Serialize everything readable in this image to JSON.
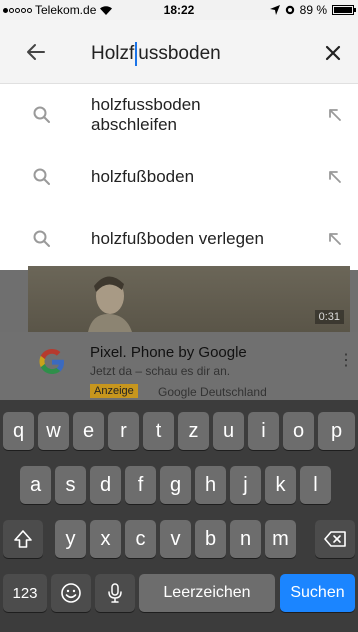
{
  "status_bar": {
    "carrier": "Telekom.de",
    "time": "18:22",
    "battery": "89 %"
  },
  "search": {
    "query_before_caret": "Holzf",
    "query_after_caret": "ussboden"
  },
  "suggestions": [
    {
      "label": "holzfussboden abschleifen"
    },
    {
      "label": "holzfußboden"
    },
    {
      "label": "holzfußboden verlegen"
    }
  ],
  "background": {
    "video_duration": "0:31",
    "ad_title": "Pixel. Phone by Google",
    "ad_subtitle": "Jetzt da – schau es dir an.",
    "ad_badge": "Anzeige",
    "ad_advertiser": "Google Deutschland"
  },
  "keyboard": {
    "row1": [
      "q",
      "w",
      "e",
      "r",
      "t",
      "z",
      "u",
      "i",
      "o",
      "p"
    ],
    "row2": [
      "a",
      "s",
      "d",
      "f",
      "g",
      "h",
      "j",
      "k",
      "l"
    ],
    "row3": [
      "y",
      "x",
      "c",
      "v",
      "b",
      "n",
      "m"
    ],
    "numbers_label": "123",
    "space_label": "Leerzeichen",
    "action_label": "Suchen"
  },
  "colors": {
    "caret": "#1a73e8",
    "action_key": "#1b85ff",
    "ad_badge": "#c7961d"
  }
}
